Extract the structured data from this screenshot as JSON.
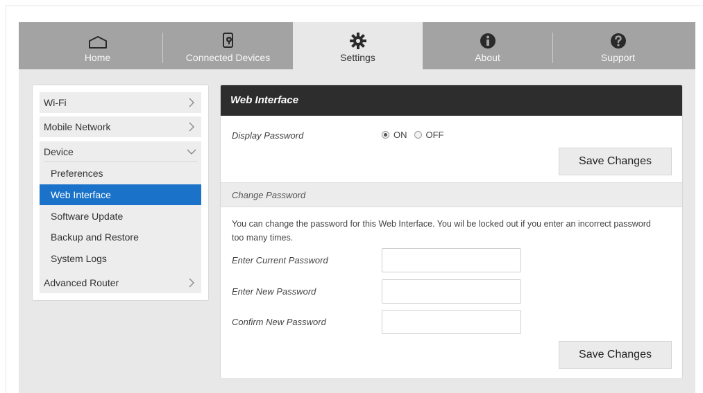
{
  "nav": {
    "tabs": [
      {
        "label": "Home",
        "icon": "home-icon"
      },
      {
        "label": "Connected Devices",
        "icon": "devices-icon"
      },
      {
        "label": "Settings",
        "icon": "gear-icon",
        "active": true
      },
      {
        "label": "About",
        "icon": "info-icon"
      },
      {
        "label": "Support",
        "icon": "help-icon"
      }
    ]
  },
  "sidebar": {
    "items": [
      {
        "label": "Wi-Fi"
      },
      {
        "label": "Mobile Network"
      },
      {
        "label": "Device",
        "expanded": true
      },
      {
        "label": "Advanced Router"
      }
    ],
    "device_sub": [
      {
        "label": "Preferences"
      },
      {
        "label": "Web Interface",
        "active": true
      },
      {
        "label": "Software Update"
      },
      {
        "label": "Backup and Restore"
      },
      {
        "label": "System Logs"
      }
    ]
  },
  "panel": {
    "title": "Web Interface",
    "display_password": {
      "label": "Display Password",
      "on_label": "ON",
      "off_label": "OFF",
      "selected": "ON"
    },
    "save_label_1": "Save Changes",
    "change_password": {
      "heading": "Change Password",
      "description": "You can change the password for this Web Interface. You wil be locked out if you enter an incorrect password too many times.",
      "current_label": "Enter Current Password",
      "current_value": "",
      "new_label": "Enter New Password",
      "new_value": "",
      "confirm_label": "Confirm New Password",
      "confirm_value": ""
    },
    "save_label_2": "Save Changes"
  },
  "colors": {
    "nav_bg": "#a3a3a3",
    "page_bg": "#e8e8e8",
    "accent": "#1a73c9",
    "panel_header": "#2d2d2d"
  }
}
